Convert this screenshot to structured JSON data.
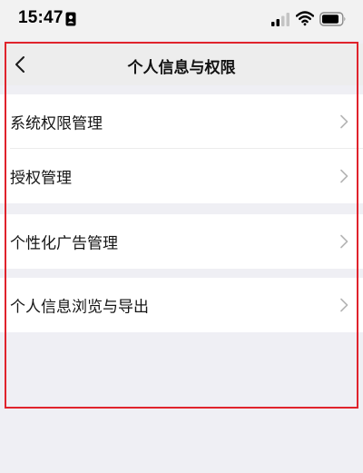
{
  "status_bar": {
    "time": "15:47",
    "icons": [
      "id-card-icon",
      "signal-icon",
      "wifi-icon",
      "battery-icon"
    ]
  },
  "nav": {
    "title": "个人信息与权限",
    "back_icon": "chevron-left-icon"
  },
  "groups": [
    {
      "items": [
        {
          "label": "系统权限管理",
          "icon": "chevron-right-icon"
        },
        {
          "label": "授权管理",
          "icon": "chevron-right-icon"
        }
      ]
    },
    {
      "items": [
        {
          "label": "个性化广告管理",
          "icon": "chevron-right-icon"
        }
      ]
    },
    {
      "items": [
        {
          "label": "个人信息浏览与导出",
          "icon": "chevron-right-icon"
        }
      ]
    }
  ],
  "colors": {
    "background": "#efeff4",
    "nav_background": "#ededed",
    "row_background": "#ffffff",
    "highlight_border": "#e0232c",
    "chevron": "#b5b5b5"
  }
}
